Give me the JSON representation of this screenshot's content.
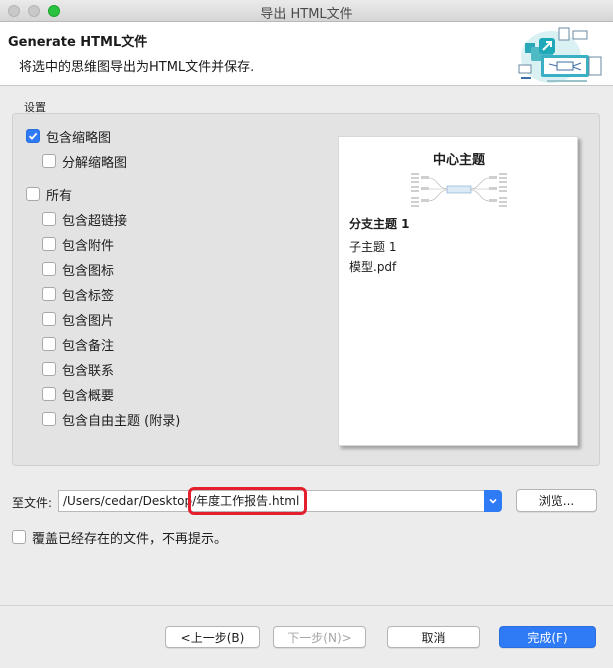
{
  "window": {
    "title": "导出 HTML文件"
  },
  "header": {
    "title": "Generate HTML文件",
    "subtitle": "将选中的思维图导出为HTML文件并保存."
  },
  "settings": {
    "group_label": "设置",
    "include_thumbnail": {
      "label": "包含缩略图",
      "checked": true
    },
    "split_thumbnail": {
      "label": "分解缩略图",
      "checked": false
    },
    "all": {
      "label": "所有",
      "checked": false
    },
    "options": [
      {
        "label": "包含超链接",
        "checked": false
      },
      {
        "label": "包含附件",
        "checked": false
      },
      {
        "label": "包含图标",
        "checked": false
      },
      {
        "label": "包含标签",
        "checked": false
      },
      {
        "label": "包含图片",
        "checked": false
      },
      {
        "label": "包含备注",
        "checked": false
      },
      {
        "label": "包含联系",
        "checked": false
      },
      {
        "label": "包含概要",
        "checked": false
      },
      {
        "label": "包含自由主题 (附录)",
        "checked": false
      }
    ]
  },
  "preview": {
    "title": "中心主题",
    "branch": "分支主题 1",
    "subtopic": "子主题 1",
    "file": "模型.pdf"
  },
  "output": {
    "label": "至文件:",
    "path_prefix": "/Users/cedar/Desktop/",
    "filename": "年度工作报告.html",
    "browse": "浏览..."
  },
  "overwrite": {
    "label": "覆盖已经存在的文件，不再提示。",
    "checked": false
  },
  "buttons": {
    "back": "<上一步(B)",
    "next": "下一步(N)>",
    "cancel": "取消",
    "finish": "完成(F)"
  },
  "colors": {
    "accent": "#2f7bf5",
    "highlight": "#e5202e"
  }
}
